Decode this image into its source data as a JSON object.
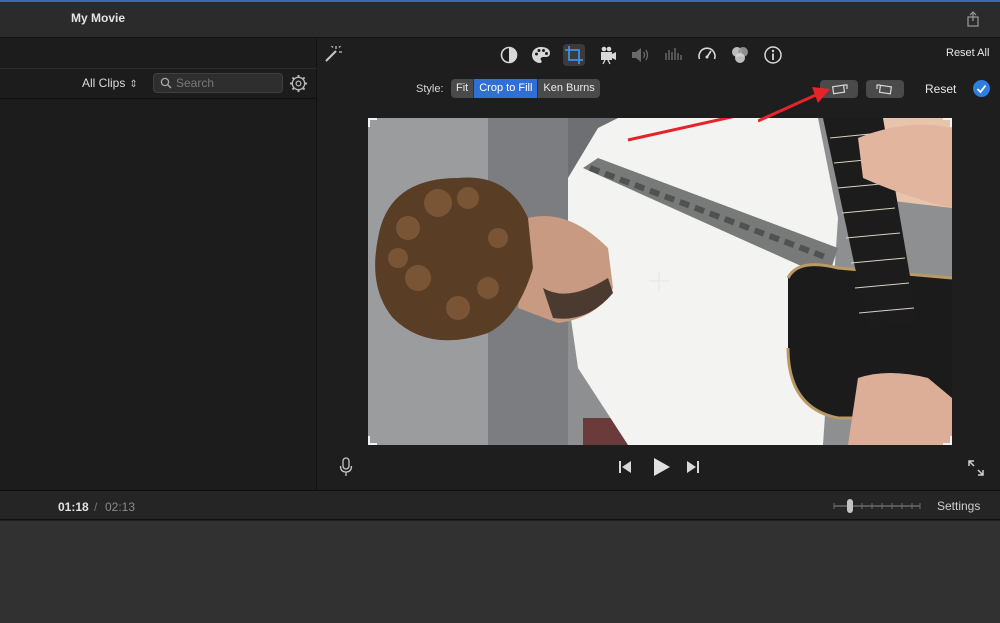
{
  "window": {
    "title": "My Movie"
  },
  "browser": {
    "filter_label": "All Clips",
    "search": {
      "placeholder": "Search",
      "value": ""
    }
  },
  "toolbar": {
    "reset_all_label": "Reset All",
    "tools": [
      "magic-wand",
      "color-balance",
      "color-correction",
      "crop",
      "stabilization",
      "volume",
      "noise-reduction",
      "speed",
      "clip-filter",
      "info"
    ],
    "active_tool": "crop"
  },
  "crop": {
    "style_label": "Style:",
    "styles": [
      {
        "label": "Fit",
        "selected": false
      },
      {
        "label": "Crop to Fill",
        "selected": true
      },
      {
        "label": "Ken Burns",
        "selected": false
      }
    ],
    "reset_label": "Reset",
    "accent_color": "#2f6fd6"
  },
  "playback": {
    "current_time": "01:18",
    "separator": "/",
    "total_time": "02:13",
    "settings_label": "Settings"
  }
}
